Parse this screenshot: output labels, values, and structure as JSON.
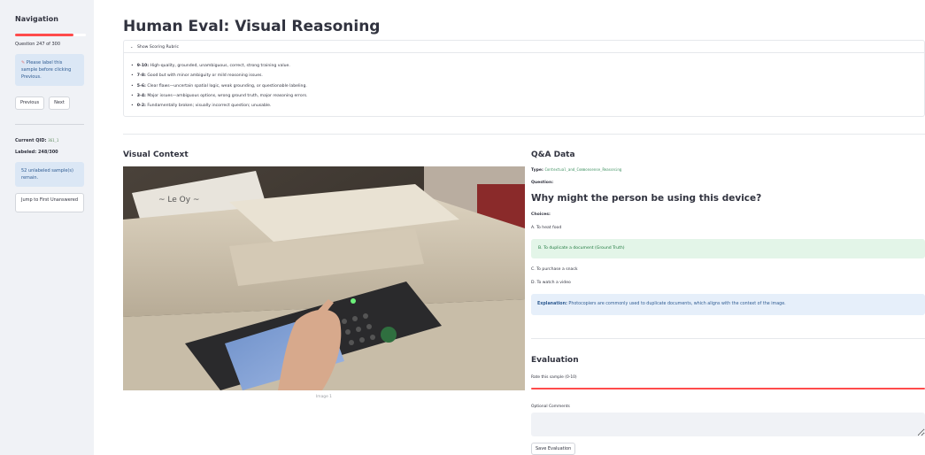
{
  "sidebar": {
    "title": "Navigation",
    "progress_fraction": 0.823,
    "question_counter": "Question 247 of 300",
    "warning_icon": "pencil-warning-icon",
    "warning_text": "Please label this sample before clicking Previous.",
    "prev_label": "Previous",
    "next_label": "Next",
    "current_qid_label": "Current QID:",
    "current_qid_value": "361_1",
    "labeled_text": "Labeled: 248/300",
    "unlabeled_text": "52 unlabeled sample(s) remain.",
    "jump_label": "Jump to First Unanswered"
  },
  "header": {
    "title": "Human Eval: Visual Reasoning"
  },
  "rubric": {
    "toggle_label": "Show Scoring Rubric",
    "items": [
      {
        "range": "9-10:",
        "text": " High-quality, grounded, unambiguous, correct, strong training value."
      },
      {
        "range": "7-8:",
        "text": " Good but with minor ambiguity or mild reasoning issues."
      },
      {
        "range": "5-6:",
        "text": " Clear flaws—uncertain spatial logic, weak grounding, or questionable labeling."
      },
      {
        "range": "3-4:",
        "text": " Major issues—ambiguous options, wrong ground truth, major reasoning errors."
      },
      {
        "range": "0-2:",
        "text": " Fundamentally broken; visually incorrect question; unusable."
      }
    ]
  },
  "visual": {
    "title": "Visual Context",
    "caption": "Image 1"
  },
  "qa": {
    "title": "Q&A Data",
    "type_label": "Type:",
    "type_value": "Contextual_and_Commonsense_Reasoning",
    "question_label": "Question:",
    "question": "Why might the person be using this device?",
    "choices_label": "Choices:",
    "choice_a": "A. To heat food",
    "choice_b": "B. To duplicate a document (Ground Truth)",
    "choice_c": "C. To purchase a snack",
    "choice_d": "D. To watch a video",
    "explanation_label": "Explanation:",
    "explanation": " Photocopiers are commonly used to duplicate documents, which aligns with the context of the image."
  },
  "evaluation": {
    "title": "Evaluation",
    "rate_label": "Rate this sample (0-10)",
    "comments_label": "Optional Comments",
    "comments_value": "",
    "save_label": "Save Evaluation"
  },
  "colors": {
    "accent": "#ff4b4b",
    "sidebar_bg": "#f0f2f6",
    "info_bg": "#dbe7f5",
    "success_bg": "#e3f5e8"
  }
}
